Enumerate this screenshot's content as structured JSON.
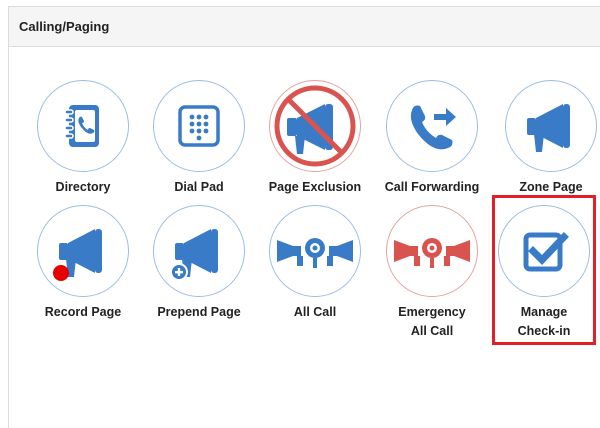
{
  "panel": {
    "title": "Calling/Paging"
  },
  "tiles": [
    {
      "label": "Directory",
      "icon": "directory-icon"
    },
    {
      "label": "Dial Pad",
      "icon": "dialpad-icon"
    },
    {
      "label": "Page Exclusion",
      "icon": "page-exclusion-icon"
    },
    {
      "label": "Call Forwarding",
      "icon": "call-forwarding-icon"
    },
    {
      "label": "Zone Page",
      "icon": "zone-page-icon"
    },
    {
      "label": "Record Page",
      "icon": "record-page-icon"
    },
    {
      "label": "Prepend Page",
      "icon": "prepend-page-icon"
    },
    {
      "label": "All Call",
      "icon": "all-call-icon"
    },
    {
      "label_line1": "Emergency",
      "label_line2": "All Call",
      "icon": "emergency-all-call-icon"
    },
    {
      "label_line1": "Manage",
      "label_line2": "Check-in",
      "icon": "checkbox-icon"
    }
  ],
  "colors": {
    "accent_blue": "#3a7bc8",
    "alert_red": "#d9534f",
    "highlight_red": "#e41e26",
    "record_dot": "#e60000"
  }
}
